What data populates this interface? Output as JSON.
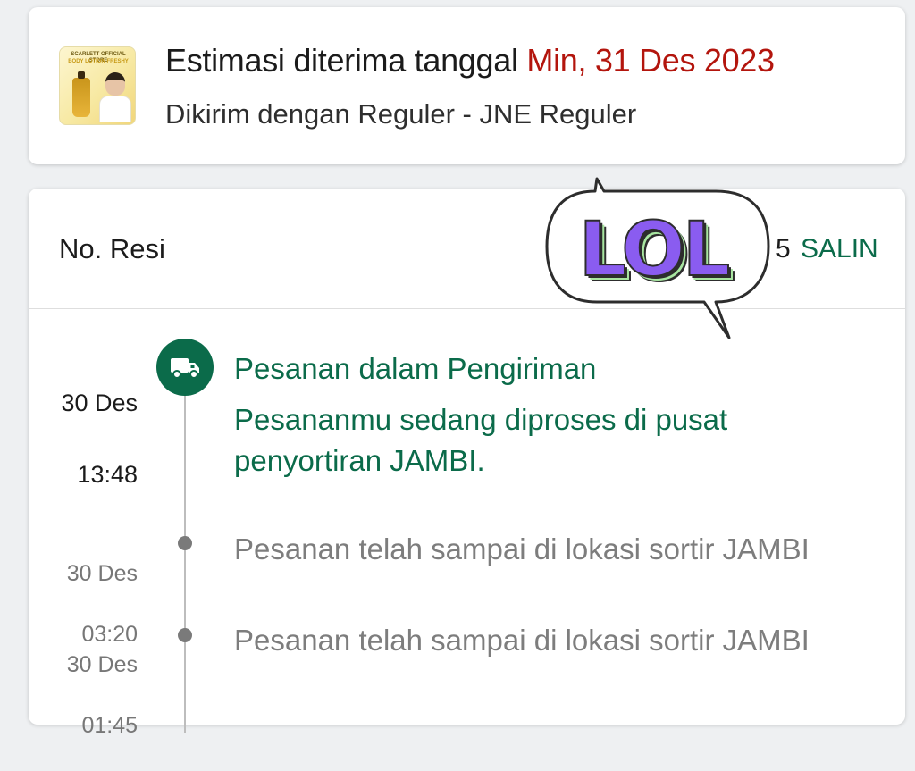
{
  "delivery": {
    "eta_label": "Estimasi diterima tanggal",
    "eta_date": "Min, 31 Des 2023",
    "shipping_method": "Dikirim dengan Reguler - JNE Reguler",
    "product_thumb": {
      "line1": "SCARLETT OFFICIAL STORE",
      "line2": "BODY LOTION FRESHY"
    }
  },
  "tracking": {
    "resi_label": "No. Resi",
    "resi_visible_tail": "5",
    "copy_label": "SALIN",
    "events": [
      {
        "date": "30 Des",
        "time": "13:48",
        "title": "Pesanan dalam Pengiriman",
        "description": "Pesananmu sedang diproses di pusat penyortiran JAMBI.",
        "status": "active",
        "icon": "truck-icon"
      },
      {
        "date": "30 Des",
        "time": "03:20",
        "title": "Pesanan telah sampai di lokasi sortir JAMBI",
        "status": "past"
      },
      {
        "date": "30 Des",
        "time": "01:45",
        "title": "Pesanan telah sampai di lokasi sortir JAMBI",
        "status": "past"
      }
    ]
  },
  "sticker": {
    "text": "LOL"
  },
  "colors": {
    "accent_green": "#0b6b4a",
    "eta_red": "#b3150d",
    "muted_gray": "#7d7d7d",
    "sticker_purple": "#8a5cf0",
    "sticker_mint": "#a8e6a1"
  }
}
